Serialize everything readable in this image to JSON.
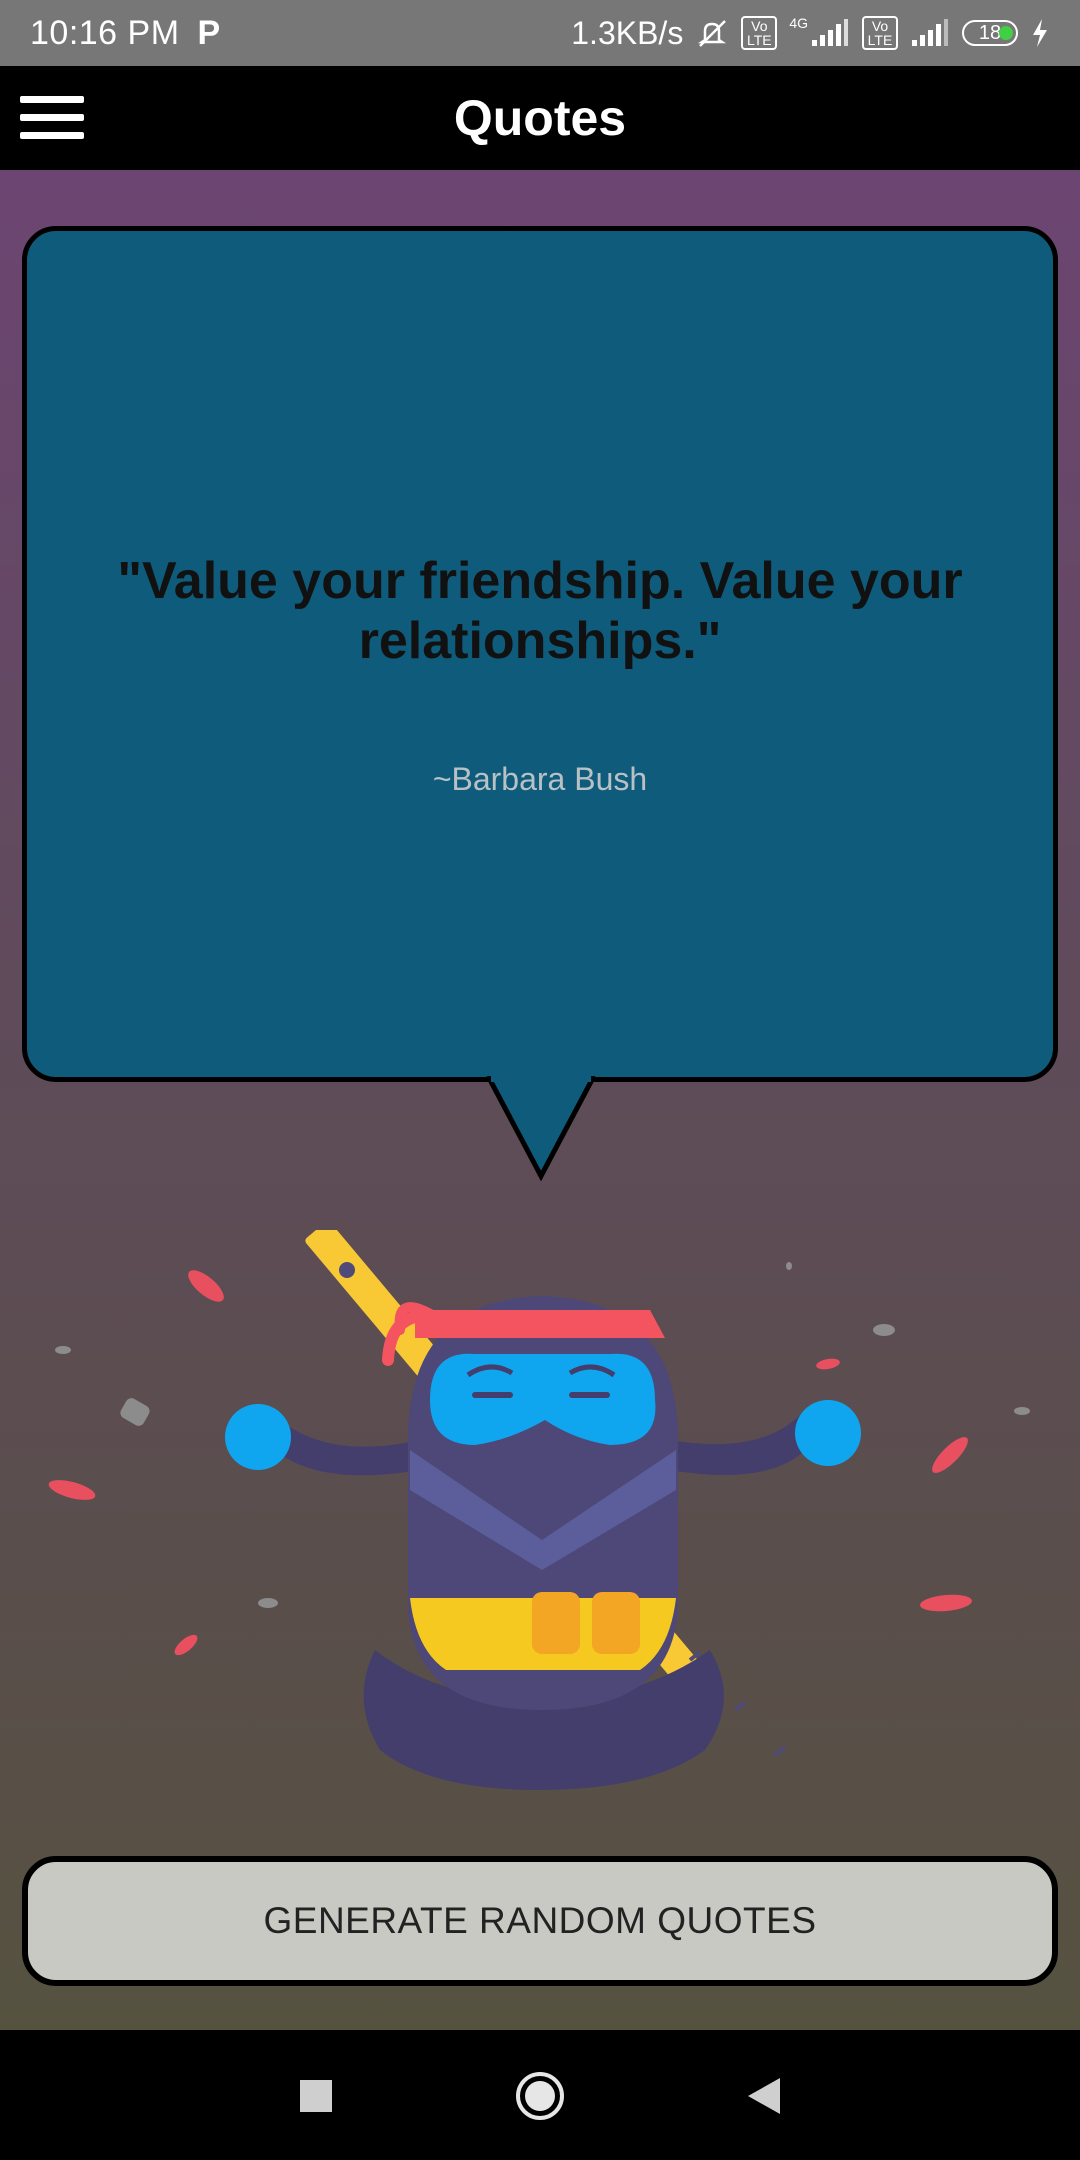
{
  "status_bar": {
    "time": "10:16 PM",
    "left_icon": "P",
    "net_speed": "1.3KB/s",
    "network_4g": "4G",
    "volte_label": "Vo LTE",
    "battery_level": "18",
    "icons": [
      "silent-bell-icon",
      "volte-icon",
      "signal-icon",
      "volte-icon",
      "signal-icon",
      "battery-icon",
      "charging-icon"
    ]
  },
  "app_bar": {
    "title": "Quotes",
    "menu_icon": "hamburger-menu-icon"
  },
  "quote": {
    "text": "\"Value your friendship. Value your relationships.\"",
    "author": "~Barbara Bush"
  },
  "illustration": "meditating-ninja",
  "actions": {
    "generate_label": "GENERATE RANDOM QUOTES"
  },
  "nav_bar": {
    "icons": [
      "recent-apps-icon",
      "home-icon",
      "back-icon"
    ]
  },
  "colors": {
    "status_bar": "#777777",
    "app_bar": "#000000",
    "bubble": "#0e5b7b",
    "button": "#c9c9c4",
    "bg_top": "#6c4572",
    "bg_bottom": "#565240"
  }
}
